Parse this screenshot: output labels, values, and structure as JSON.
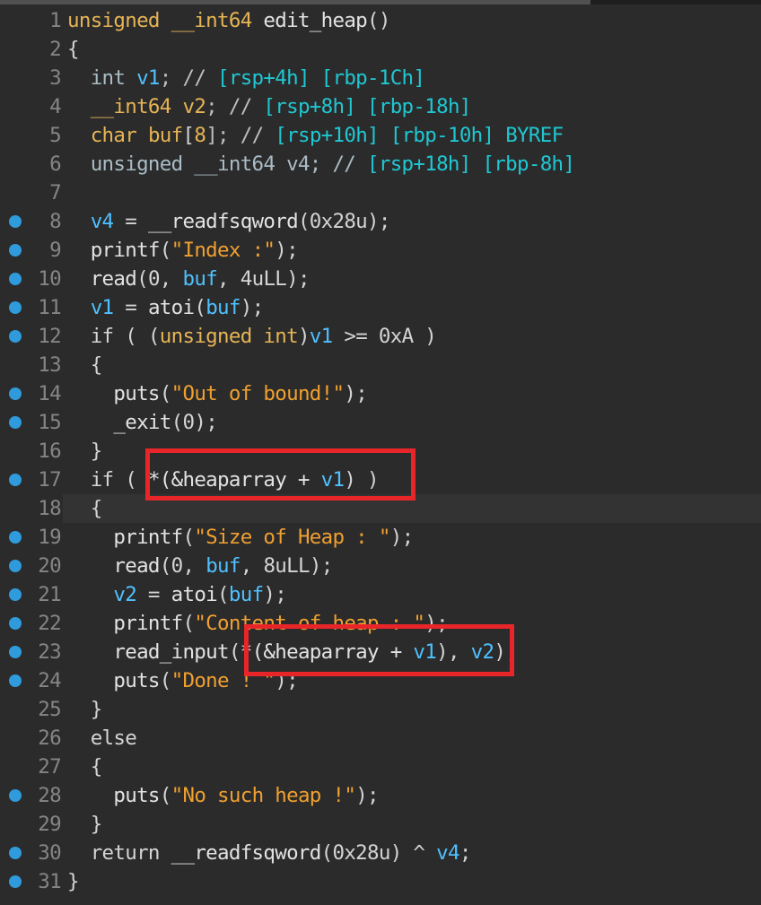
{
  "editor": {
    "lines": [
      {
        "n": "1",
        "bp": false,
        "hl": false,
        "t": [
          [
            "unsigned __int64 ",
            "kw"
          ],
          [
            "edit_heap",
            "fn"
          ],
          [
            "()",
            "pn"
          ]
        ]
      },
      {
        "n": "2",
        "bp": false,
        "hl": false,
        "t": [
          [
            "{",
            "pn"
          ]
        ]
      },
      {
        "n": "3",
        "bp": false,
        "hl": false,
        "t": [
          [
            "  int ",
            "ty"
          ],
          [
            "v1",
            "vr"
          ],
          [
            "; // ",
            "cm"
          ],
          [
            "[rsp+4h] [rbp-1Ch]",
            "cv"
          ]
        ]
      },
      {
        "n": "4",
        "bp": false,
        "hl": false,
        "t": [
          [
            "  __int64 ",
            "kw"
          ],
          [
            "v2",
            "kw"
          ],
          [
            "; // ",
            "cm"
          ],
          [
            "[rsp+8h] [rbp-18h]",
            "cv"
          ]
        ]
      },
      {
        "n": "5",
        "bp": false,
        "hl": false,
        "t": [
          [
            "  char ",
            "kw"
          ],
          [
            "buf",
            "kw"
          ],
          [
            "[",
            "pn"
          ],
          [
            "8",
            "kw"
          ],
          [
            "]; // ",
            "cm"
          ],
          [
            "[rsp+10h] [rbp-10h] BYREF",
            "cv"
          ]
        ]
      },
      {
        "n": "6",
        "bp": false,
        "hl": false,
        "t": [
          [
            "  unsigned __int64 v4; // ",
            "ty"
          ],
          [
            "[rsp+18h] [rbp-8h]",
            "cv"
          ]
        ]
      },
      {
        "n": "7",
        "bp": false,
        "hl": false,
        "t": []
      },
      {
        "n": "8",
        "bp": true,
        "hl": false,
        "t": [
          [
            "  v4",
            "vr"
          ],
          [
            " = ",
            "pn"
          ],
          [
            "__readfsqword",
            "fn"
          ],
          [
            "(",
            "pn"
          ],
          [
            "0x28u",
            "nm"
          ],
          [
            ");",
            "pn"
          ]
        ]
      },
      {
        "n": "9",
        "bp": true,
        "hl": false,
        "t": [
          [
            "  printf",
            "fn"
          ],
          [
            "(",
            "pn"
          ],
          [
            "\"Index :\"",
            "st"
          ],
          [
            ");",
            "pn"
          ]
        ]
      },
      {
        "n": "10",
        "bp": true,
        "hl": false,
        "t": [
          [
            "  read",
            "fn"
          ],
          [
            "(",
            "pn"
          ],
          [
            "0",
            "nm"
          ],
          [
            ", ",
            "pn"
          ],
          [
            "buf",
            "vr"
          ],
          [
            ", ",
            "pn"
          ],
          [
            "4uLL",
            "nm"
          ],
          [
            ");",
            "pn"
          ]
        ]
      },
      {
        "n": "11",
        "bp": true,
        "hl": false,
        "t": [
          [
            "  v1",
            "vr"
          ],
          [
            " = ",
            "pn"
          ],
          [
            "atoi",
            "fn"
          ],
          [
            "(",
            "pn"
          ],
          [
            "buf",
            "vr"
          ],
          [
            ");",
            "pn"
          ]
        ]
      },
      {
        "n": "12",
        "bp": true,
        "hl": false,
        "t": [
          [
            "  if ( (",
            "pn"
          ],
          [
            "unsigned int",
            "kw"
          ],
          [
            ")",
            "pn"
          ],
          [
            "v1",
            "vr"
          ],
          [
            " >= ",
            "pn"
          ],
          [
            "0xA",
            "nm"
          ],
          [
            " )",
            "pn"
          ]
        ]
      },
      {
        "n": "13",
        "bp": false,
        "hl": false,
        "t": [
          [
            "  {",
            "pn"
          ]
        ]
      },
      {
        "n": "14",
        "bp": true,
        "hl": false,
        "t": [
          [
            "    puts",
            "fn"
          ],
          [
            "(",
            "pn"
          ],
          [
            "\"Out of bound!\"",
            "st"
          ],
          [
            ");",
            "pn"
          ]
        ]
      },
      {
        "n": "15",
        "bp": true,
        "hl": false,
        "t": [
          [
            "    _exit",
            "fn"
          ],
          [
            "(",
            "pn"
          ],
          [
            "0",
            "nm"
          ],
          [
            ");",
            "pn"
          ]
        ]
      },
      {
        "n": "16",
        "bp": false,
        "hl": false,
        "t": [
          [
            "  }",
            "pn"
          ]
        ]
      },
      {
        "n": "17",
        "bp": true,
        "hl": false,
        "t": [
          [
            "  if ( ",
            "pn"
          ],
          [
            "*(&heaparray + ",
            "fn"
          ],
          [
            "v1",
            "vr"
          ],
          [
            ")",
            "pn"
          ],
          [
            " )",
            "pn"
          ]
        ]
      },
      {
        "n": "18",
        "bp": false,
        "hl": true,
        "t": [
          [
            "  {",
            "pn"
          ]
        ]
      },
      {
        "n": "19",
        "bp": true,
        "hl": false,
        "t": [
          [
            "    printf",
            "fn"
          ],
          [
            "(",
            "pn"
          ],
          [
            "\"Size of Heap : \"",
            "st"
          ],
          [
            ");",
            "pn"
          ]
        ]
      },
      {
        "n": "20",
        "bp": true,
        "hl": false,
        "t": [
          [
            "    read",
            "fn"
          ],
          [
            "(",
            "pn"
          ],
          [
            "0",
            "nm"
          ],
          [
            ", ",
            "pn"
          ],
          [
            "buf",
            "vr"
          ],
          [
            ", ",
            "pn"
          ],
          [
            "8uLL",
            "nm"
          ],
          [
            ");",
            "pn"
          ]
        ]
      },
      {
        "n": "21",
        "bp": true,
        "hl": false,
        "t": [
          [
            "    v2",
            "vr"
          ],
          [
            " = ",
            "pn"
          ],
          [
            "atoi",
            "fn"
          ],
          [
            "(",
            "pn"
          ],
          [
            "buf",
            "vr"
          ],
          [
            ");",
            "pn"
          ]
        ]
      },
      {
        "n": "22",
        "bp": true,
        "hl": false,
        "t": [
          [
            "    printf",
            "fn"
          ],
          [
            "(",
            "pn"
          ],
          [
            "\"Content of heap : \"",
            "st"
          ],
          [
            ");",
            "pn"
          ]
        ]
      },
      {
        "n": "23",
        "bp": true,
        "hl": false,
        "t": [
          [
            "    read_input",
            "fn"
          ],
          [
            "(",
            "pn"
          ],
          [
            "*(&heaparray + ",
            "fn"
          ],
          [
            "v1",
            "vr"
          ],
          [
            "), ",
            "pn"
          ],
          [
            "v2",
            "vr"
          ],
          [
            ");",
            "pn"
          ]
        ]
      },
      {
        "n": "24",
        "bp": true,
        "hl": false,
        "t": [
          [
            "    puts",
            "fn"
          ],
          [
            "(",
            "pn"
          ],
          [
            "\"Done ! \"",
            "st"
          ],
          [
            ");",
            "pn"
          ]
        ]
      },
      {
        "n": "25",
        "bp": false,
        "hl": false,
        "t": [
          [
            "  }",
            "pn"
          ]
        ]
      },
      {
        "n": "26",
        "bp": false,
        "hl": false,
        "t": [
          [
            "  else",
            "pn"
          ]
        ]
      },
      {
        "n": "27",
        "bp": false,
        "hl": false,
        "t": [
          [
            "  {",
            "pn"
          ]
        ]
      },
      {
        "n": "28",
        "bp": true,
        "hl": false,
        "t": [
          [
            "    puts",
            "fn"
          ],
          [
            "(",
            "pn"
          ],
          [
            "\"No such heap !\"",
            "st"
          ],
          [
            ");",
            "pn"
          ]
        ]
      },
      {
        "n": "29",
        "bp": false,
        "hl": false,
        "t": [
          [
            "  }",
            "pn"
          ]
        ]
      },
      {
        "n": "30",
        "bp": true,
        "hl": false,
        "t": [
          [
            "  return ",
            "pn"
          ],
          [
            "__readfsqword",
            "fn"
          ],
          [
            "(",
            "pn"
          ],
          [
            "0x28u",
            "nm"
          ],
          [
            ") ^ ",
            "pn"
          ],
          [
            "v4",
            "vr"
          ],
          [
            ";",
            "pn"
          ]
        ]
      },
      {
        "n": "31",
        "bp": true,
        "hl": false,
        "t": [
          [
            "}",
            "pn"
          ]
        ]
      }
    ]
  }
}
